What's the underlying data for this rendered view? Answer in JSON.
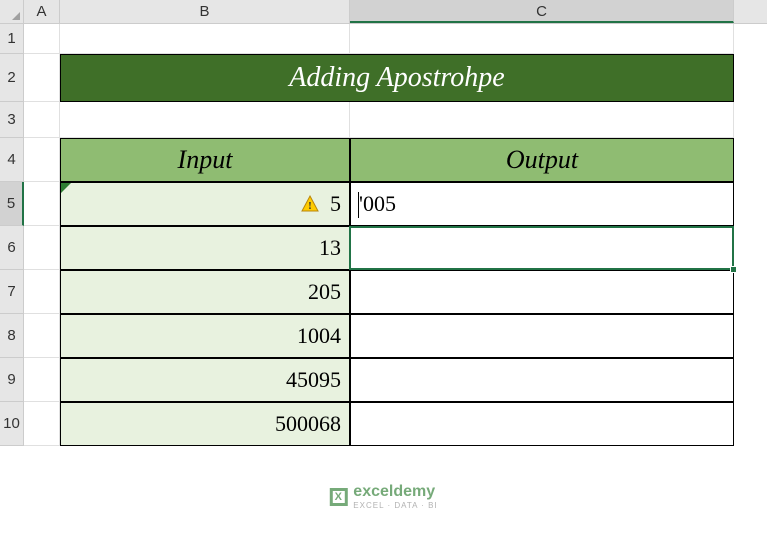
{
  "columns": {
    "A": "A",
    "B": "B",
    "C": "C"
  },
  "rows": [
    "1",
    "2",
    "3",
    "4",
    "5",
    "6",
    "7",
    "8",
    "9",
    "10"
  ],
  "title": "Adding Apostrohpe",
  "headers": {
    "input": "Input",
    "output": "Output"
  },
  "data": {
    "inputs": [
      "5",
      "13",
      "205",
      "1004",
      "45095",
      "500068"
    ],
    "outputs": [
      "'005",
      "",
      "",
      "",
      "",
      ""
    ]
  },
  "activeCell": {
    "col": "C",
    "row": 5
  },
  "errorIndicator": {
    "row": 5,
    "col": "B"
  },
  "watermark": {
    "brand": "exceldemy",
    "tagline": "EXCEL · DATA · BI"
  },
  "chart_data": {
    "type": "table",
    "title": "Adding Apostrohpe",
    "columns": [
      "Input",
      "Output"
    ],
    "rows": [
      {
        "Input": "5",
        "Output": "'005"
      },
      {
        "Input": "13",
        "Output": ""
      },
      {
        "Input": "205",
        "Output": ""
      },
      {
        "Input": "1004",
        "Output": ""
      },
      {
        "Input": "45095",
        "Output": ""
      },
      {
        "Input": "500068",
        "Output": ""
      }
    ]
  }
}
